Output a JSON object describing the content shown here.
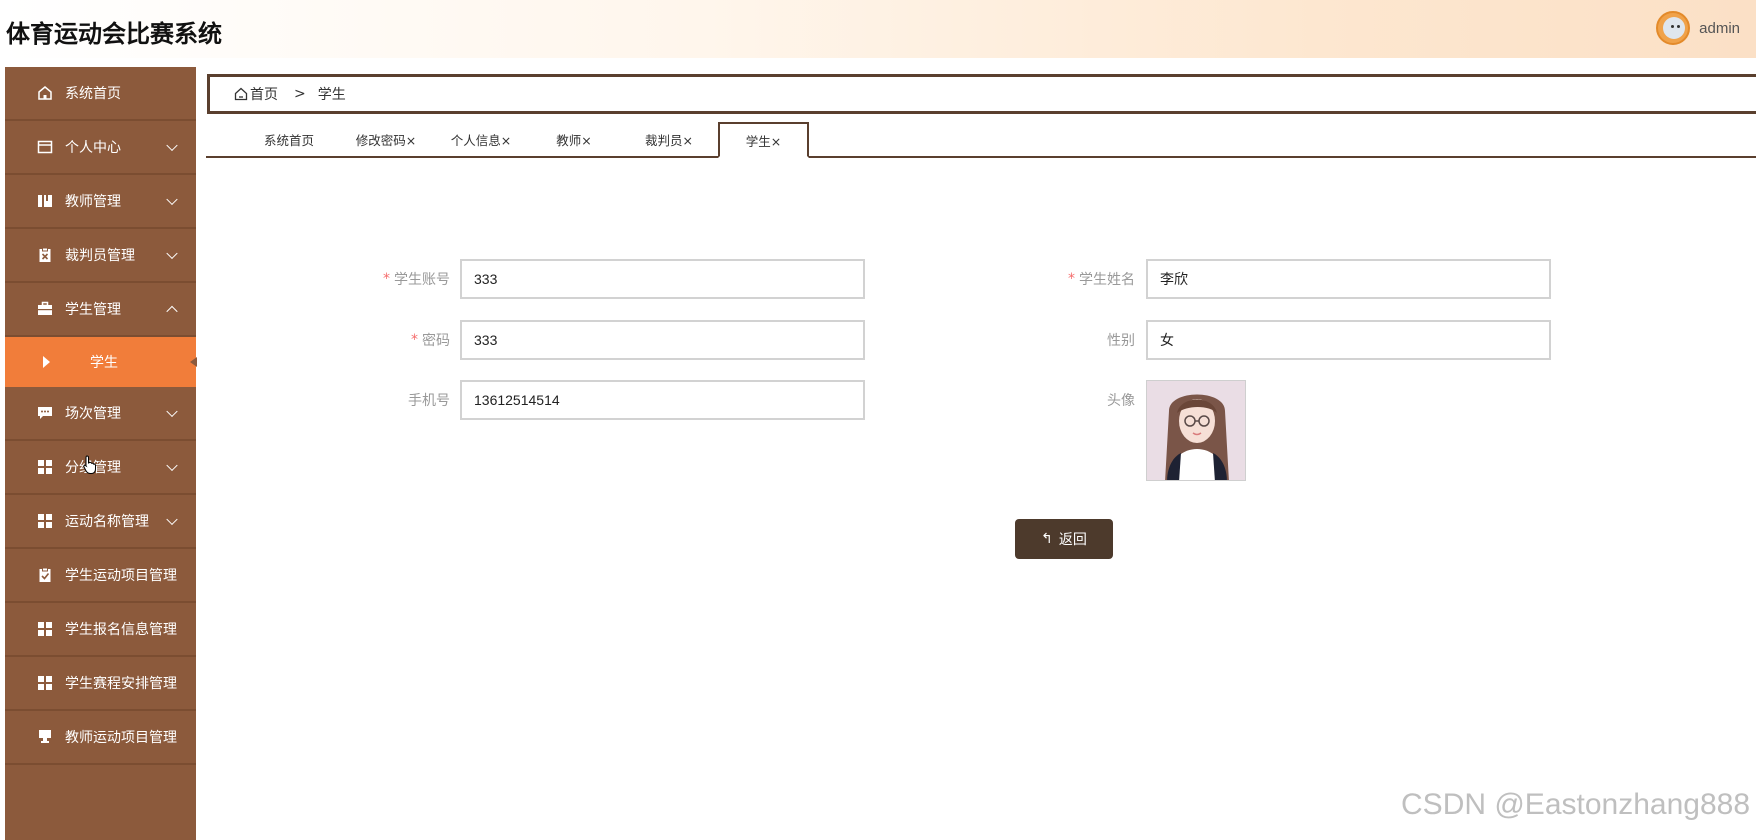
{
  "app": {
    "title": "体育运动会比赛系统",
    "username": "admin"
  },
  "sidebar": {
    "items": [
      {
        "label": "系统首页",
        "icon": "home-icon",
        "expandable": false
      },
      {
        "label": "个人中心",
        "icon": "profile-icon",
        "expandable": true,
        "expanded": false
      },
      {
        "label": "教师管理",
        "icon": "book-icon",
        "expandable": true,
        "expanded": false
      },
      {
        "label": "裁判员管理",
        "icon": "clipboard-x-icon",
        "expandable": true,
        "expanded": false
      },
      {
        "label": "学生管理",
        "icon": "briefcase-icon",
        "expandable": true,
        "expanded": true
      },
      {
        "label": "场次管理",
        "icon": "chat-icon",
        "expandable": true,
        "expanded": false
      },
      {
        "label": "分组管理",
        "icon": "grid-icon",
        "expandable": true,
        "expanded": false
      },
      {
        "label": "运动名称管理",
        "icon": "grid-icon",
        "expandable": true,
        "expanded": false
      },
      {
        "label": "学生运动项目管理",
        "icon": "clipboard-check-icon",
        "expandable": false
      },
      {
        "label": "学生报名信息管理",
        "icon": "grid-icon",
        "expandable": false
      },
      {
        "label": "学生赛程安排管理",
        "icon": "grid-icon",
        "expandable": false
      },
      {
        "label": "教师运动项目管理",
        "icon": "stamp-icon",
        "expandable": false
      }
    ],
    "active_sub": "学生"
  },
  "breadcrumb": {
    "home": "首页",
    "separator": ">",
    "current": "学生"
  },
  "tabs": [
    {
      "label": "系统首页",
      "closable": false,
      "active": false
    },
    {
      "label": "修改密码×",
      "closable": true,
      "active": false
    },
    {
      "label": "个人信息×",
      "closable": true,
      "active": false
    },
    {
      "label": "教师×",
      "closable": true,
      "active": false
    },
    {
      "label": "裁判员×",
      "closable": true,
      "active": false
    },
    {
      "label": "学生×",
      "closable": true,
      "active": true
    }
  ],
  "form": {
    "account": {
      "label": "学生账号",
      "required": true,
      "value": "333"
    },
    "name": {
      "label": "学生姓名",
      "required": true,
      "value": "李欣"
    },
    "password": {
      "label": "密码",
      "required": true,
      "value": "333"
    },
    "gender": {
      "label": "性别",
      "required": false,
      "value": "女"
    },
    "phone": {
      "label": "手机号",
      "required": false,
      "value": "13612514514"
    },
    "avatar": {
      "label": "头像"
    },
    "back_button": "返回"
  },
  "watermark": "CSDN @Eastonzhang888",
  "colors": {
    "sidebar": "#8c5a3c",
    "sidebar_active": "#f17d3a",
    "accent_dark": "#5a3f2e",
    "button": "#4d3a2c",
    "required": "#f56c6c"
  }
}
